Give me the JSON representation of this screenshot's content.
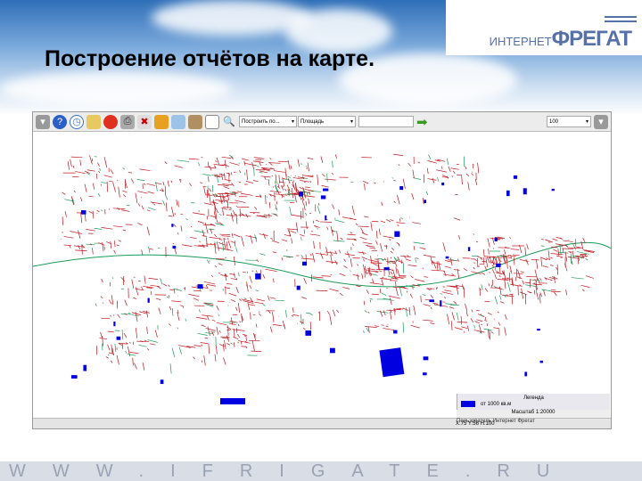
{
  "slide": {
    "title": "Построение отчётов на карте.",
    "footer": "WWW.IFRIGATE.RU"
  },
  "logo": {
    "prefix": "ИНТЕРНЕТ",
    "name": "ФРЕГАТ"
  },
  "toolbar": {
    "icons": [
      "panel-toggle-icon",
      "help-icon",
      "clock-icon",
      "folder-icon",
      "pie-chart-icon",
      "print-icon",
      "delete-icon",
      "ruler-icon",
      "zoom-area-icon",
      "layers-icon",
      "select-icon",
      "search-icon"
    ],
    "report_select": "Построить по...",
    "field_select": "Площадь",
    "value_input": "",
    "scale_select": "100"
  },
  "legend": {
    "title": "Легенда",
    "items": [
      {
        "label": "от 1000 кв.м",
        "color": "#0000e0"
      }
    ],
    "scale_text": "Масштаб 1:20000"
  },
  "status": {
    "coords": "X:75 Y:56 H:100",
    "user": "Пользователь Интернет Фрегат"
  },
  "colors": {
    "roads": "#c0141b",
    "green": "#1a9a5a",
    "buildings": "#0000e0"
  }
}
